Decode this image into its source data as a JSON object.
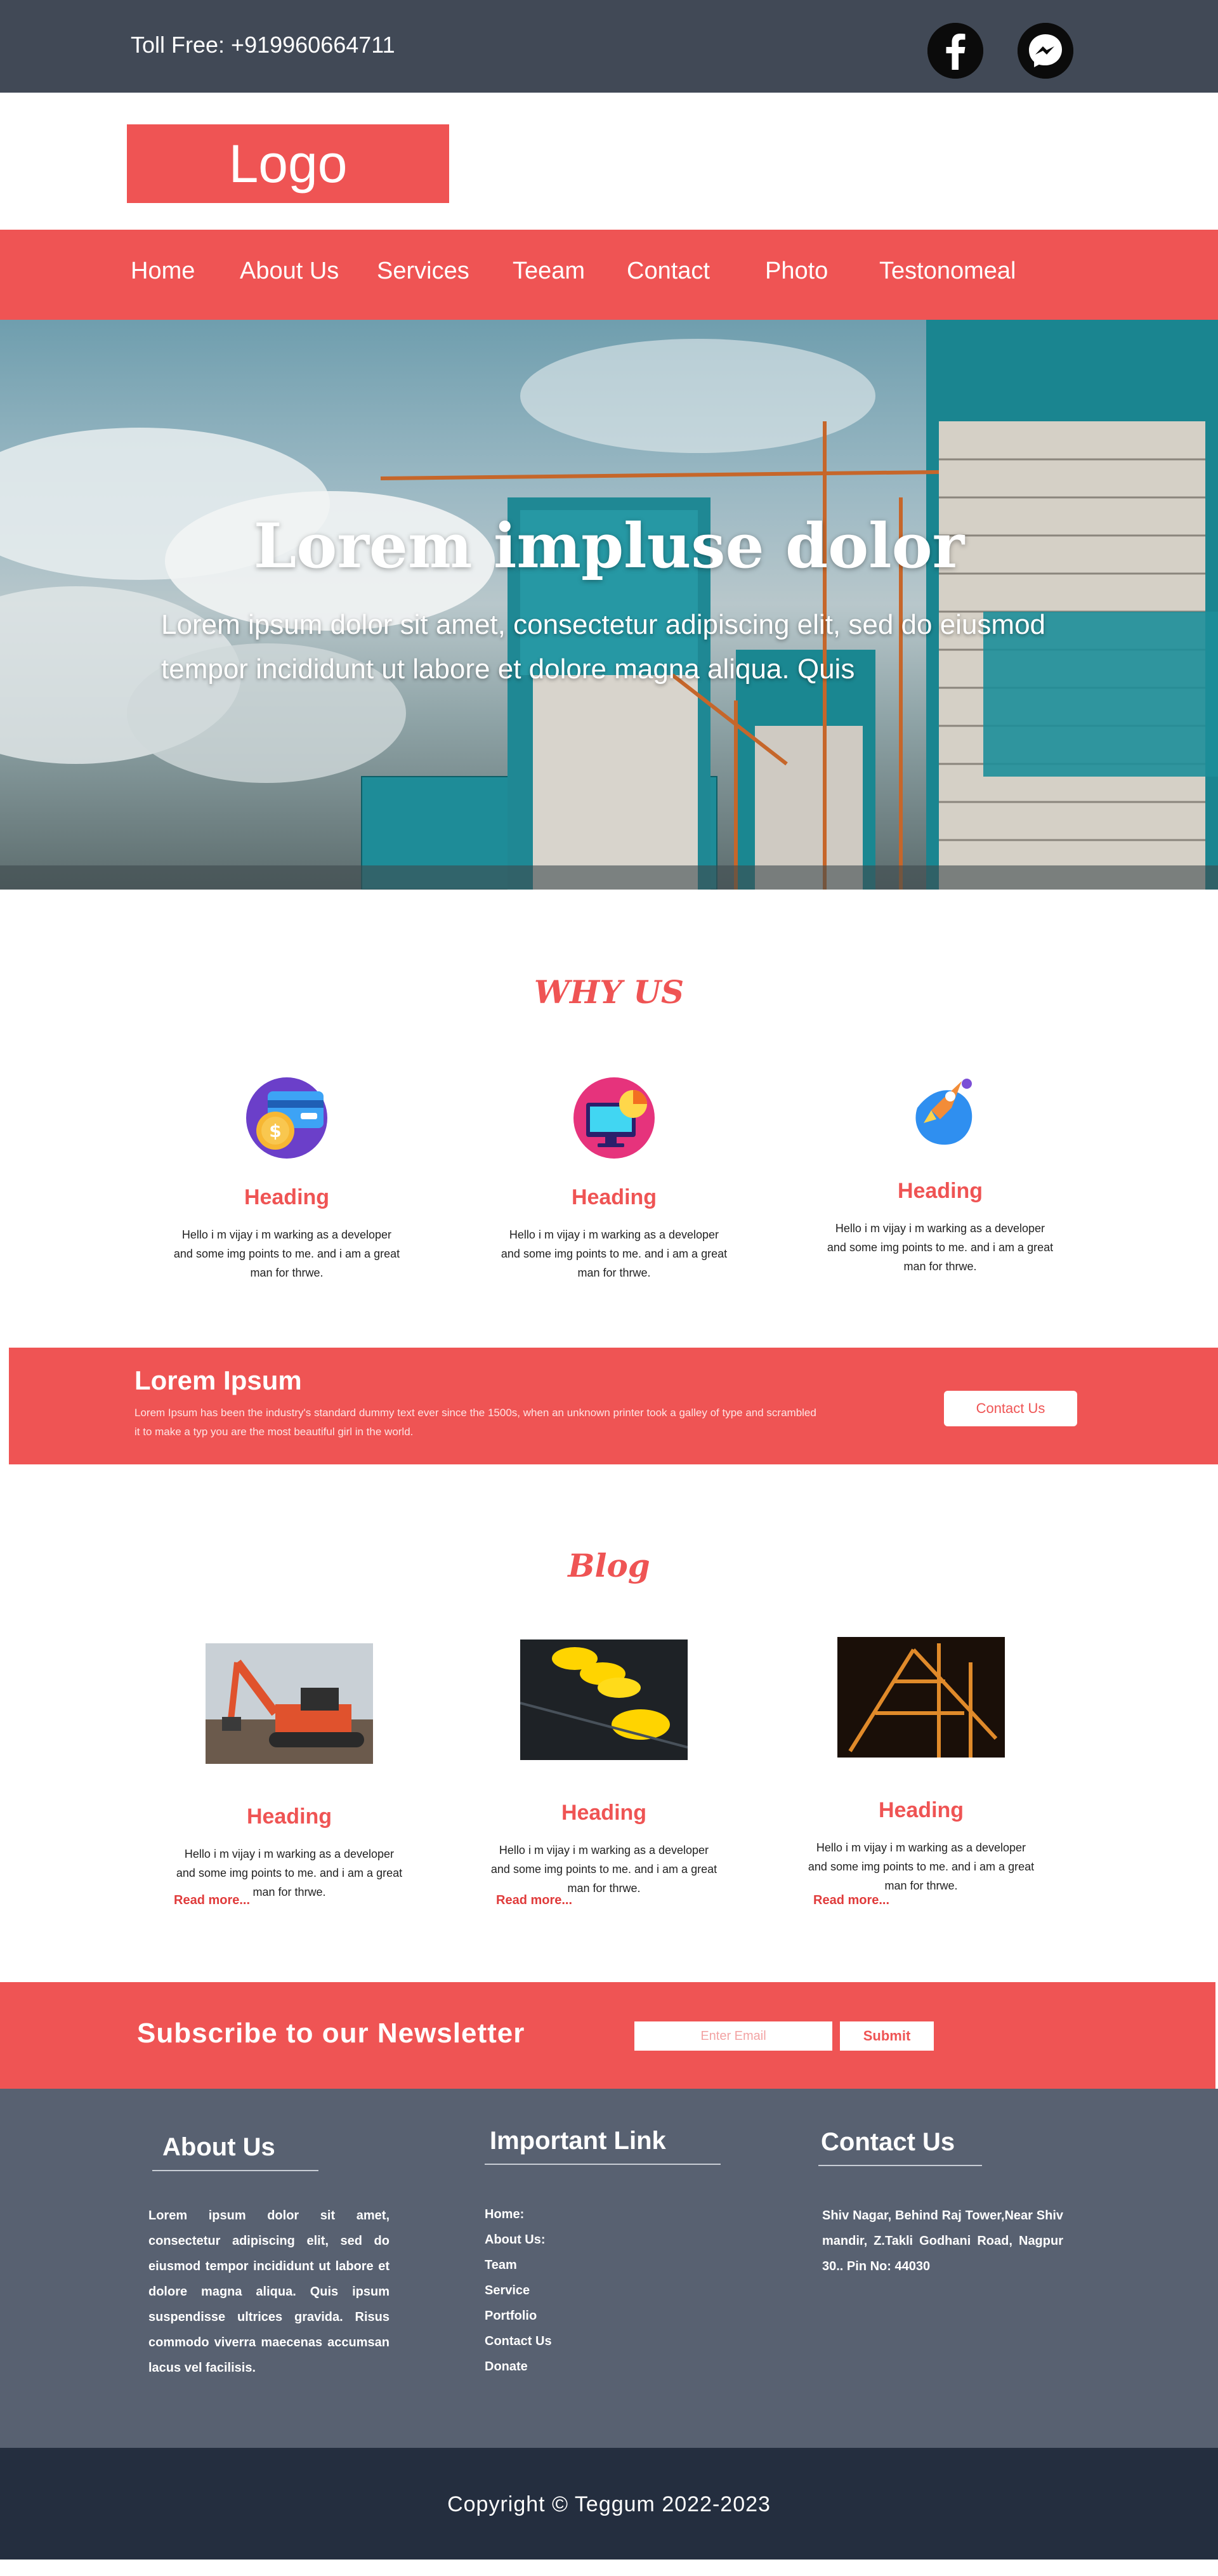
{
  "topbar": {
    "toll_free": "Toll Free: +919960664711"
  },
  "logo": {
    "text": "Logo"
  },
  "nav": {
    "items": [
      "Home",
      "About Us",
      "Services",
      "Teeam",
      "Contact",
      "Photo",
      "Testonomeal"
    ]
  },
  "hero": {
    "title": "Lorem impluse dolor",
    "text": "Lorem ipsum dolor sit amet, consectetur adipiscing elit, sed do eiusmod tempor incididunt ut labore et dolore magna aliqua. Quis"
  },
  "why_us": {
    "title": "WHY US",
    "cards": [
      {
        "icon": "credit-card-coin-icon",
        "heading": "Heading",
        "text": "Hello i m vijay i m warking as a developer and some img points to me. and i am a great man for thrwe."
      },
      {
        "icon": "monitor-chart-icon",
        "heading": "Heading",
        "text": "Hello i m vijay i m warking as a developer and some img points to me. and i am a great man for thrwe."
      },
      {
        "icon": "rocket-icon",
        "heading": "Heading",
        "text": "Hello i m vijay i m warking as a developer and some img points to me. and i am a great man for thrwe."
      }
    ]
  },
  "lorem_band": {
    "title": "Lorem Ipsum",
    "text": "Lorem Ipsum has been the industry's standard dummy text ever since the 1500s, when an unknown printer took a galley of type and scrambled it to make a typ  you are the most beautiful girl in the world.",
    "button": "Contact Us"
  },
  "blog": {
    "title": "Blog",
    "posts": [
      {
        "image": "excavator-photo",
        "heading": "Heading",
        "text": "Hello i m vijay i m warking as a developer and some img points to me. and i am a great man for thrwe.",
        "read_more": "Read more..."
      },
      {
        "image": "hard-hats-photo",
        "heading": "Heading",
        "text": "Hello i m vijay i m warking as a developer and some img points to me. and i am a great man for thrwe.",
        "read_more": "Read more..."
      },
      {
        "image": "steel-structure-photo",
        "heading": "Heading",
        "text": "Hello i m vijay i m warking as a developer and some img points to me. and i am a great man for thrwe.",
        "read_more": "Read more..."
      }
    ]
  },
  "newsletter": {
    "title": "Subscribe to our Newsletter",
    "placeholder": "Enter Email",
    "button": "Submit"
  },
  "footer": {
    "about_title": "About Us",
    "about_text": "Lorem ipsum dolor sit amet, consectetur adipiscing elit, sed do eiusmod tempor incididunt ut labore et dolore magna aliqua. Quis ipsum suspendisse ultrices gravida. Risus commodo viverra maecenas accumsan lacus vel facilisis.",
    "links_title": "Important Link",
    "links": [
      "Home:",
      "About Us:",
      "Team",
      "Service",
      "Portfolio",
      "Contact Us",
      "Donate"
    ],
    "contact_title": "Contact Us",
    "contact_text": "Shiv Nagar, Behind Raj Tower,Near Shiv mandir, Z.Takli Godhani Road, Nagpur 30.. Pin No: 44030"
  },
  "copyright": "Copyright © Teggum 2022-2023",
  "colors": {
    "accent": "#ef5454",
    "topbar": "#414956",
    "footer": "#586171",
    "copyright_bg": "#242e3f"
  }
}
